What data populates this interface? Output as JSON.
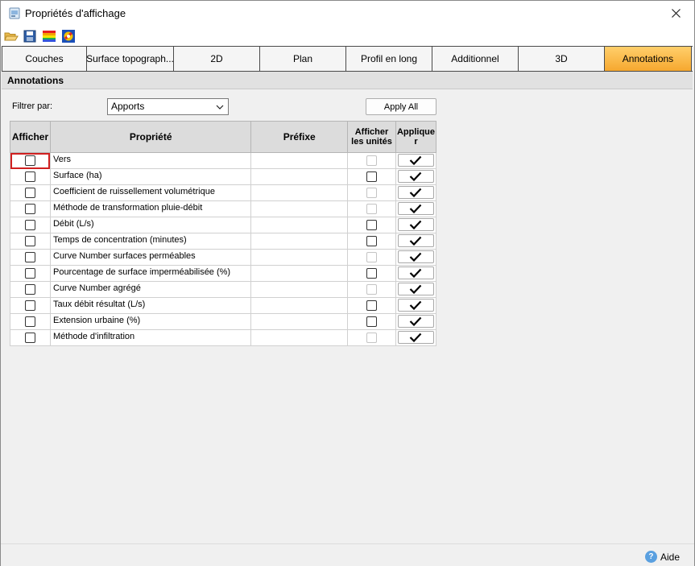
{
  "window": {
    "title": "Propriétés d'affichage"
  },
  "tabs": [
    {
      "label": "Couches",
      "width": 106
    },
    {
      "label": "Surface topograph...",
      "width": 108
    },
    {
      "label": "2D",
      "width": 107
    },
    {
      "label": "Plan",
      "width": 107
    },
    {
      "label": "Profil en long",
      "width": 107
    },
    {
      "label": "Additionnel",
      "width": 107
    },
    {
      "label": "3D",
      "width": 107
    },
    {
      "label": "Annotations",
      "width": 108,
      "active": true
    }
  ],
  "section": {
    "title": "Annotations"
  },
  "filter": {
    "label": "Filtrer par:",
    "selected": "Apports"
  },
  "apply_all_label": "Apply All",
  "grid": {
    "headers": {
      "show": "Afficher",
      "property": "Propriété",
      "prefix": "Préfixe",
      "show_units": "Afficher les unités",
      "apply": "Applique r"
    },
    "rows": [
      {
        "name": "Vers",
        "units_enabled": false
      },
      {
        "name": "Surface (ha)",
        "units_enabled": true
      },
      {
        "name": "Coefficient de ruissellement volumétrique",
        "units_enabled": false
      },
      {
        "name": "Méthode de transformation pluie-débit",
        "units_enabled": false
      },
      {
        "name": "Débit (L/s)",
        "units_enabled": true
      },
      {
        "name": "Temps de concentration (minutes)",
        "units_enabled": true
      },
      {
        "name": "Curve Number surfaces perméables",
        "units_enabled": false
      },
      {
        "name": "Pourcentage de surface imperméabilisée (%)",
        "units_enabled": true
      },
      {
        "name": "Curve Number agrégé",
        "units_enabled": false
      },
      {
        "name": "Taux débit résultat (L/s)",
        "units_enabled": true
      },
      {
        "name": "Extension urbaine (%)",
        "units_enabled": true
      },
      {
        "name": "Méthode d'infiltration",
        "units_enabled": false
      }
    ]
  },
  "footer": {
    "help_label": "Aide"
  },
  "colors": {
    "active_tab": "#f6a82f",
    "focus_border": "#d02020"
  }
}
